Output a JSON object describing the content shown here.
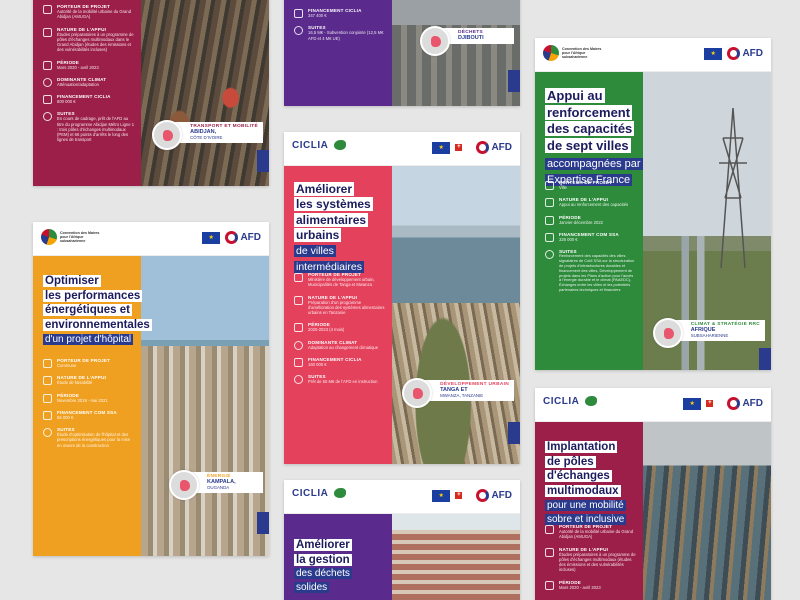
{
  "cards": {
    "abidjan": {
      "info": [
        {
          "label": "PORTEUR DE PROJET",
          "value": "Autorité de la mobilité urbaine du Grand Abidjan (AMUGA)"
        },
        {
          "label": "NATURE DE L'APPUI",
          "value": "Études préparatoires à un programme de pôles d'échanges multimodaux dans le Grand Abidjan (études des émissions et des vulnérabilités incluses)"
        },
        {
          "label": "PÉRIODE",
          "value": "Mars 2020 - avril 2023"
        },
        {
          "label": "DOMINANTE CLIMAT",
          "value": "Atténuation/adaptation"
        },
        {
          "label": "FINANCEMENT CICLIA",
          "value": "800 000 €"
        },
        {
          "label": "SUITES",
          "value": "En cours de cadrage, prêt de l'AFD au titre du programme Abidjan Métro Ligne 1 : trois pôles d'échanges multimodaux (PEM) et 66 points d'arrêts le long des lignes de transport"
        }
      ],
      "tag": {
        "category": "TRANSPORT ET MOBILITÉ",
        "place": "ABIDJAN,",
        "country": "CÔTE D'IVOIRE"
      }
    },
    "djibouti": {
      "info": [
        {
          "label": "FINANCEMENT CICLIA",
          "value": "347 400 €"
        },
        {
          "label": "SUITES",
          "value": "16,5 M€ - Subvention conjointe (12,5 M€ AFD et 4 M€ UE)"
        }
      ],
      "tag": {
        "category": "DÉCHETS",
        "place": "DJIBOUTI",
        "country": ""
      }
    },
    "energie": {
      "logo": "Convention des Maires pour l'Afrique subsaharienne",
      "title": [
        "Optimiser",
        "les performances",
        "énergétiques et",
        "environnementales"
      ],
      "subtitle": [
        "d'un projet d'hôpital"
      ],
      "info": [
        {
          "label": "PORTEUR DE PROJET",
          "value": "Commune"
        },
        {
          "label": "NATURE DE L'APPUI",
          "value": "Étude de faisabilité"
        },
        {
          "label": "PÉRIODE",
          "value": "Novembre 2019 - mai 2021"
        },
        {
          "label": "FINANCEMENT COM SSA",
          "value": "55 000 €"
        },
        {
          "label": "SUITES",
          "value": "Étude d'optimisation de l'hôpital et des prescriptions énergétiques pour la mise en œuvre de la construction"
        }
      ],
      "tag": {
        "category": "ÉNERGIE",
        "place": "KAMPALA,",
        "country": "OUGANDA"
      }
    },
    "tanga": {
      "logo": "CICLIA",
      "title": [
        "Améliorer",
        "les systèmes",
        "alimentaires",
        "urbains"
      ],
      "subtitle": [
        "de villes",
        "intermédiaires"
      ],
      "info": [
        {
          "label": "PORTEUR DE PROJET",
          "value": "Ministère de développement urbain, Municipalités de Tanga et Mwanza"
        },
        {
          "label": "NATURE DE L'APPUI",
          "value": "Préparation d'un programme d'amélioration des systèmes alimentaires urbains en Tanzanie"
        },
        {
          "label": "PÉRIODE",
          "value": "2020-2023 (4 mois)"
        },
        {
          "label": "DOMINANTE CLIMAT",
          "value": "Adaptation au changement climatique"
        },
        {
          "label": "FINANCEMENT CICLIA",
          "value": "160 000 €"
        },
        {
          "label": "SUITES",
          "value": "Prêt de 50 M€ de l'AFD en instruction"
        }
      ],
      "tag": {
        "category": "DÉVELOPPEMENT URBAIN",
        "place": "TANGA ET",
        "country": "MWANZA, TANZANIE"
      }
    },
    "capacites": {
      "logo": "Convention des Maires pour l'Afrique subsaharienne",
      "title": [
        "Appui au",
        "renforcement",
        "des capacités",
        "de sept villes"
      ],
      "subtitle": [
        "accompagnées par",
        "Expertise France"
      ],
      "info": [
        {
          "label": "PORTEUR DE PROJET",
          "value": "Ville"
        },
        {
          "label": "NATURE DE L'APPUI",
          "value": "Appui au renforcement des capacités"
        },
        {
          "label": "PÉRIODE",
          "value": "Janvier-décembre 2022"
        },
        {
          "label": "FINANCEMENT COM SSA",
          "value": "326 000 €"
        },
        {
          "label": "SUITES",
          "value": "Renforcement des capacités des villes signataires de CoM SSA sur la structuration de projets d'infrastructures durables et financement des villes, Développement de projets dans les Plans d'action pour l'accès à l'énergie durable et le climat (PAAEDC), Échanges entre les villes et les potentiels partenaires techniques et financiers"
        }
      ],
      "tag": {
        "category": "CLIMAT & STRATÉGIE RRC",
        "place": "AFRIQUE",
        "country": "SUBSAHARIENNE"
      }
    },
    "dechets": {
      "logo": "CICLIA",
      "title": [
        "Améliorer",
        "la gestion"
      ],
      "subtitle": [
        "des déchets",
        "solides"
      ]
    },
    "poles": {
      "logo": "CICLIA",
      "title": [
        "Implantation",
        "de pôles",
        "d'échanges",
        "multimodaux"
      ],
      "subtitle": [
        "pour une mobilité",
        "sobre et inclusive"
      ],
      "info": [
        {
          "label": "PORTEUR DE PROJET",
          "value": "Autorité de la mobilité urbaine du Grand Abidjan (AMUGA)"
        },
        {
          "label": "NATURE DE L'APPUI",
          "value": "Études préparatoires à un programme de pôles d'échanges multimodaux (études des émissions et des vulnérabilités incluses)"
        },
        {
          "label": "PÉRIODE",
          "value": "Mars 2020 - avril 2023"
        }
      ]
    }
  },
  "partners": {
    "afd": "AFD",
    "eu_caption": "Financé par l'Union européenne",
    "ch_caption": "Confédération suisse"
  },
  "colors": {
    "crimson": "#9c1f4a",
    "purple": "#5a2a8c",
    "orange": "#f0a020",
    "pink": "#e4415c",
    "green": "#2e8b3c",
    "navy": "#2a3a8c"
  }
}
